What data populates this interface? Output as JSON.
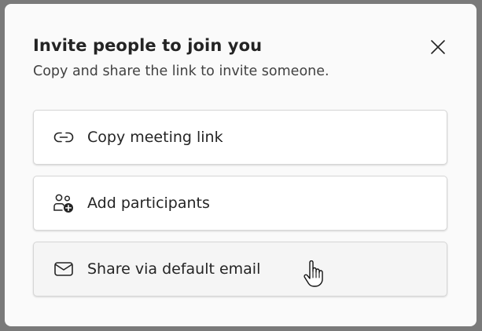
{
  "dialog": {
    "title": "Invite people to join you",
    "subtitle": "Copy and share the link to invite someone.",
    "close_icon": "close-icon"
  },
  "options": [
    {
      "label": "Copy meeting link",
      "icon": "link-icon"
    },
    {
      "label": "Add participants",
      "icon": "people-add-icon"
    },
    {
      "label": "Share via default email",
      "icon": "mail-icon"
    }
  ],
  "colors": {
    "backdrop": "#7a7a7a",
    "dialog_bg": "#fafafa",
    "text": "#242424",
    "subtext": "#424242",
    "card_border": "#d6d6d6",
    "hover_bg": "#f5f5f5"
  }
}
